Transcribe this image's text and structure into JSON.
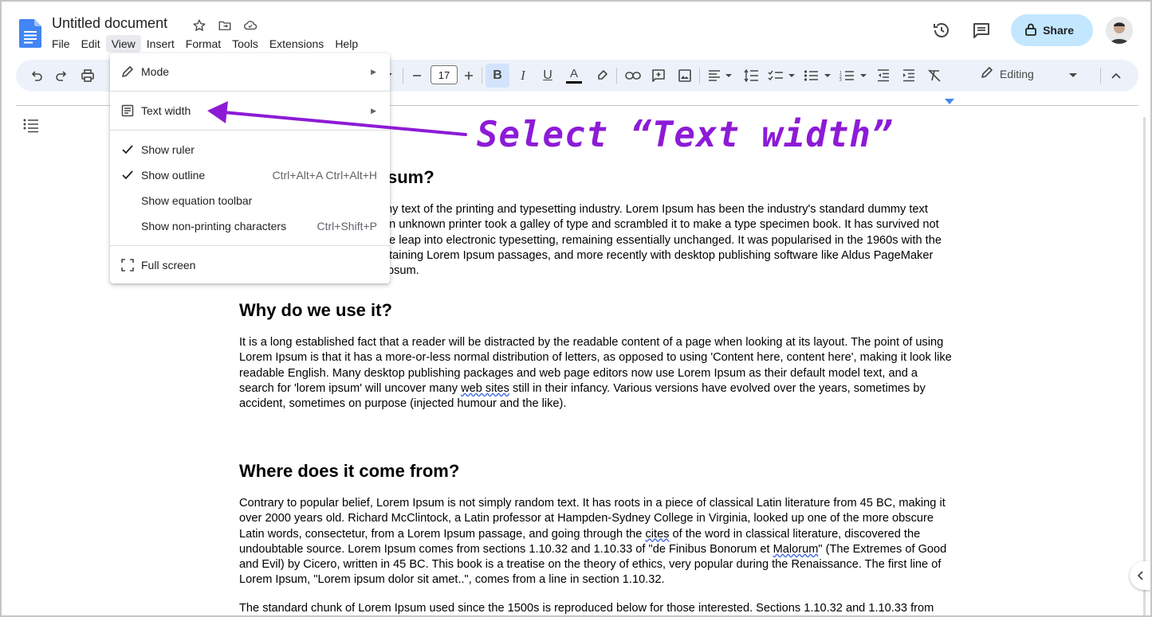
{
  "app": {
    "doc_title": "Untitled document",
    "menus": [
      "File",
      "Edit",
      "View",
      "Insert",
      "Format",
      "Tools",
      "Extensions",
      "Help"
    ],
    "active_menu": "View",
    "share_label": "Share"
  },
  "toolbar": {
    "font_size": "17",
    "editing_label": "Editing",
    "text_color_letter": "A",
    "bold_letter": "B",
    "italic_letter": "I",
    "underline_letter": "U"
  },
  "view_menu": {
    "items": [
      {
        "label": "Mode",
        "submenu": true
      },
      {
        "label": "Text width",
        "submenu": true
      },
      {
        "label": "Show ruler",
        "checked": true
      },
      {
        "label": "Show outline",
        "checked": true,
        "shortcut": "Ctrl+Alt+A Ctrl+Alt+H"
      },
      {
        "label": "Show equation toolbar"
      },
      {
        "label": "Show non-printing characters",
        "shortcut": "Ctrl+Shift+P"
      },
      {
        "label": "Full screen"
      }
    ]
  },
  "annotation": {
    "text": "Select “Text width”",
    "color": "#8d1bd6"
  },
  "document": {
    "h1_partial": "sum?",
    "p1_lines": [
      "my text of the printing and typesetting industry. Lorem Ipsum has been the industry's standard dummy text",
      "an unknown printer took a galley of type and scrambled it to make a type specimen book. It has survived not",
      "he leap into electronic typesetting, remaining essentially unchanged. It was popularised in the 1960s with the",
      "ntaining Lorem Ipsum passages, and more recently with desktop publishing software like Aldus PageMaker",
      "psum."
    ],
    "h2": "Why do we use it?",
    "p2_a": "It is a long established fact that a reader will be distracted by the readable content of a page when looking at its layout. The point of using Lorem Ipsum is that it has a more-or-less normal distribution of letters, as opposed to using 'Content here, content here', making it look like readable English. Many desktop publishing packages and web page editors now use Lorem Ipsum as their default model text, and a search for 'lorem ipsum' will uncover many ",
    "p2_link": "web sites",
    "p2_b": " still in their infancy. Various versions have evolved over the years, sometimes by accident, sometimes on purpose (injected humour and the like).",
    "h3": "Where does it come from?",
    "p3_a": "Contrary to popular belief, Lorem Ipsum is not simply random text. It has roots in a piece of classical Latin literature from 45 BC, making it over 2000 years old. Richard McClintock, a Latin professor at Hampden-Sydney College in Virginia, looked up one of the more obscure Latin words, consectetur, from a Lorem Ipsum passage, and going through the ",
    "p3_cites": "cites",
    "p3_b": " of the word in classical literature, discovered the undoubtable source. Lorem Ipsum comes from sections 1.10.32 and 1.10.33 of \"de Finibus Bonorum et ",
    "p3_malorum": "Malorum",
    "p3_c": "\" (The Extremes of Good and Evil) by Cicero, written in 45 BC. This book is a treatise on the theory of ethics, very popular during the Renaissance. The first line of Lorem Ipsum, \"Lorem ipsum dolor sit amet..\", comes from a line in section 1.10.32.",
    "p4": "The standard chunk of Lorem Ipsum used since the 1500s is reproduced below for those interested. Sections 1.10.32 and 1.10.33 from"
  },
  "icons": {
    "doc_logo": "docs-icon",
    "star": "star-icon",
    "move": "move-to-folder-icon",
    "cloud": "cloud-saved-icon",
    "history": "history-icon",
    "comments": "comments-icon",
    "lock": "lock-icon"
  }
}
